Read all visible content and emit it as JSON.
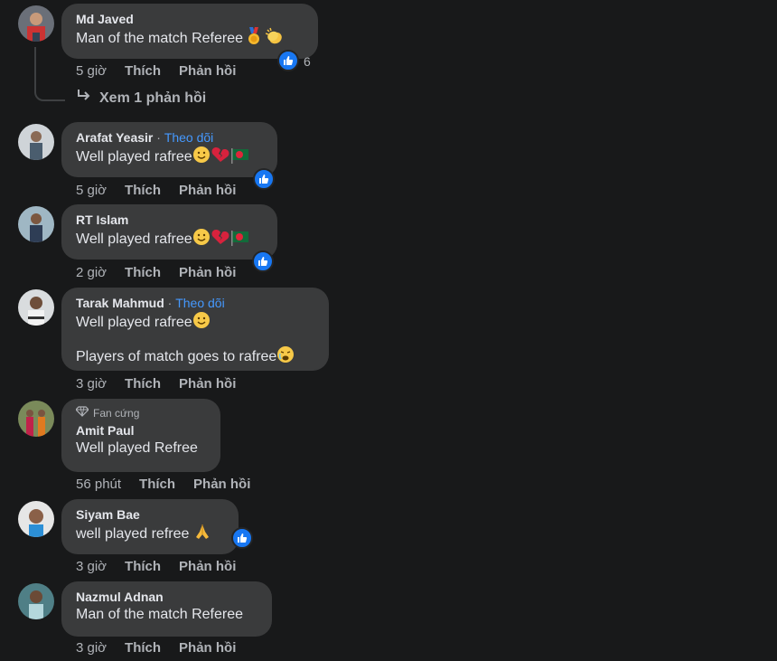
{
  "labels": {
    "like": "Thích",
    "reply": "Phản hồi",
    "follow": "Theo dõi",
    "separator": "·"
  },
  "colors": {
    "background": "#18191a",
    "bubble": "#3a3b3c",
    "link": "#4599ff",
    "like_blue": "#1877f2"
  },
  "comments": [
    {
      "author": "Md Javed",
      "lines": [
        "Man of the match Referee"
      ],
      "time": "5 giờ",
      "reaction_count": "6",
      "emojis": [
        "medal",
        "clapping-hands"
      ]
    },
    {
      "author": "Arafat Yeasir",
      "follow": true,
      "lines": [
        "Well played rafree"
      ],
      "time": "5 giờ",
      "emojis": [
        "slightly-smiling-face",
        "broken-heart",
        "bangladesh-flag"
      ]
    },
    {
      "author": "RT Islam",
      "lines": [
        "Well played rafree"
      ],
      "time": "2 giờ",
      "emojis": [
        "slightly-smiling-face",
        "broken-heart",
        "bangladesh-flag"
      ]
    },
    {
      "author": "Tarak Mahmud",
      "follow": true,
      "lines": [
        "Well played rafree",
        "Players of match goes to rafree"
      ],
      "time": "3 giờ",
      "emojis": [
        "slightly-smiling-face",
        "tired-face"
      ]
    },
    {
      "author": "Amit Paul",
      "badge": "Fan cứng",
      "lines": [
        "Well played Refree"
      ],
      "time": "56 phút"
    },
    {
      "author": "Siyam Bae",
      "lines": [
        "well played refree"
      ],
      "time": "3 giờ",
      "emojis": [
        "folded-hands"
      ]
    },
    {
      "author": "Nazmul Adnan",
      "lines": [
        "Man of the match Referee"
      ],
      "time": "3 giờ"
    }
  ],
  "view_replies": "Xem 1 phản hồi"
}
